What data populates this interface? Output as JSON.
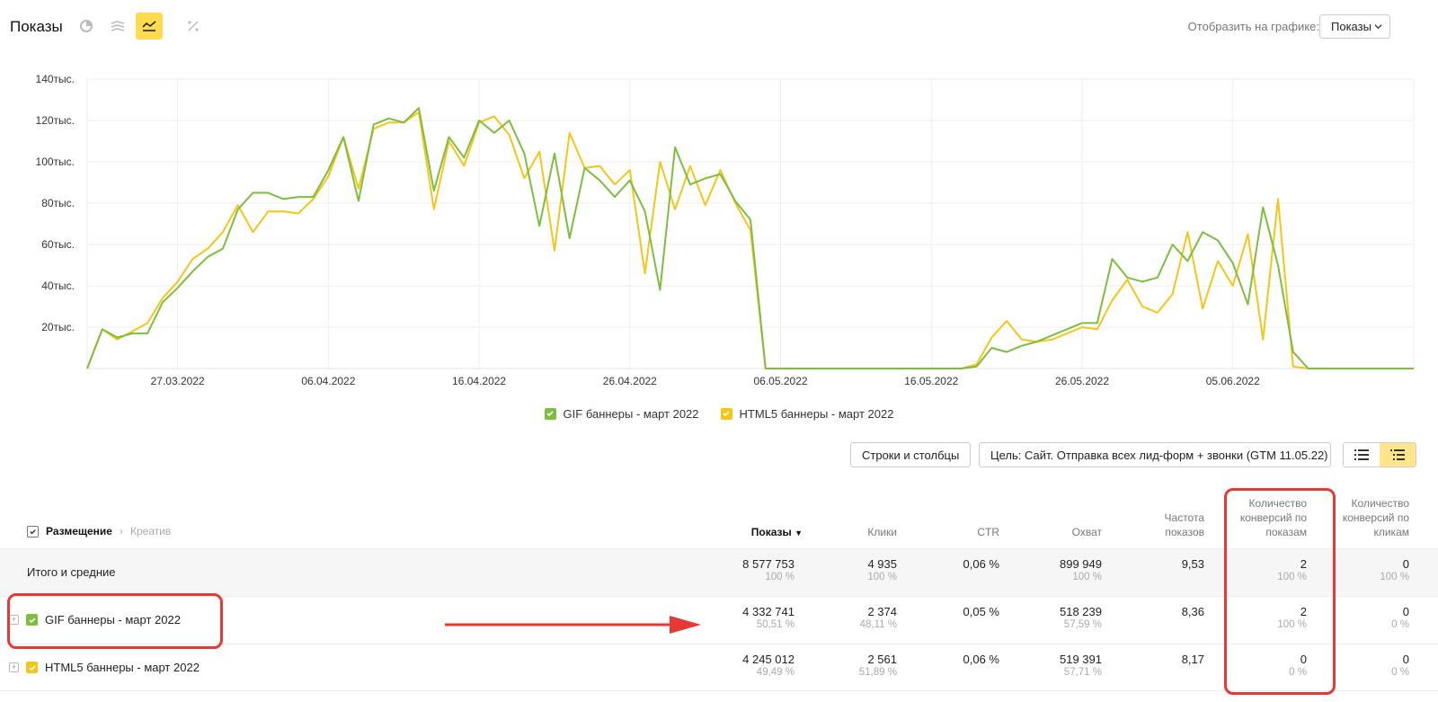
{
  "header": {
    "title": "Показы",
    "display_label": "Отобразить на графике:",
    "display_value": "Показы"
  },
  "chart_data": {
    "type": "line",
    "y_ticks": [
      "20тыс.",
      "40тыс.",
      "60тыс.",
      "80тыс.",
      "100тыс.",
      "120тыс.",
      "140тыс."
    ],
    "x_ticks": [
      "27.03.2022",
      "06.04.2022",
      "16.04.2022",
      "26.04.2022",
      "06.05.2022",
      "16.05.2022",
      "26.05.2022",
      "05.06.2022"
    ],
    "ylim": [
      0,
      140000
    ],
    "grid": true,
    "legend_position": "bottom-center",
    "series": [
      {
        "name": "GIF баннеры - март 2022",
        "color": "#7dbd3f",
        "values": [
          0,
          19000,
          15000,
          17000,
          17000,
          32000,
          39000,
          47000,
          54000,
          58000,
          77000,
          85000,
          85000,
          82000,
          83000,
          83000,
          96000,
          112000,
          81000,
          118000,
          121000,
          119000,
          126000,
          86000,
          112000,
          102000,
          120000,
          114000,
          120000,
          104000,
          69000,
          104000,
          63000,
          97000,
          91000,
          83000,
          91000,
          76000,
          38000,
          107000,
          89000,
          92000,
          94000,
          81000,
          72000,
          0,
          0,
          0,
          0,
          0,
          0,
          0,
          0,
          0,
          0,
          0,
          0,
          0,
          0,
          1000,
          10000,
          8000,
          11000,
          13000,
          16000,
          19000,
          22000,
          22000,
          53000,
          44000,
          42000,
          44000,
          60000,
          52000,
          66000,
          62000,
          51000,
          31000,
          78000,
          50000,
          8000,
          0,
          0,
          0,
          0,
          0,
          0,
          0,
          0
        ]
      },
      {
        "name": "HTML5 баннеры - март 2022",
        "color": "#f5c518",
        "values": [
          0,
          19000,
          14000,
          18000,
          22000,
          34000,
          42000,
          53000,
          58000,
          66000,
          79000,
          66000,
          76000,
          76000,
          75000,
          82000,
          93000,
          112000,
          87000,
          116000,
          119000,
          119000,
          124000,
          77000,
          110000,
          98000,
          119000,
          122000,
          113000,
          92000,
          105000,
          57000,
          114000,
          97000,
          98000,
          89000,
          96000,
          46000,
          100000,
          77000,
          98000,
          79000,
          96000,
          80000,
          67000,
          0,
          0,
          0,
          0,
          0,
          0,
          0,
          0,
          0,
          0,
          0,
          0,
          0,
          0,
          2000,
          15000,
          23000,
          14000,
          13000,
          14000,
          17000,
          20000,
          19000,
          33000,
          43000,
          30000,
          27000,
          36000,
          66000,
          29000,
          52000,
          40000,
          65000,
          14000,
          82000,
          1000,
          0,
          0,
          0,
          0,
          0,
          0,
          0,
          0
        ]
      }
    ]
  },
  "toolbar": {
    "rows_columns_label": "Строки и столбцы",
    "goal_label": "Цель: Сайт. Отправка всех лид-форм + звонки (GTM 11.05.22)"
  },
  "table": {
    "breadcrumb_active": "Размещение",
    "breadcrumb_separator": "›",
    "breadcrumb_next": "Креатив",
    "columns": {
      "shows": "Показы",
      "shows_sort": "▼",
      "clicks": "Клики",
      "ctr": "CTR",
      "reach": "Охват",
      "freq_l1": "Частота",
      "freq_l2": "показов",
      "conv_views_l1": "Количество",
      "conv_views_l2": "конверсий по",
      "conv_views_l3": "показам",
      "conv_clicks_l1": "Количество",
      "conv_clicks_l2": "конверсий по",
      "conv_clicks_l3": "кликам"
    },
    "total": {
      "label": "Итого и средние",
      "shows": "8 577 753",
      "shows_pct": "100 %",
      "clicks": "4 935",
      "clicks_pct": "100 %",
      "ctr": "0,06 %",
      "reach": "899 949",
      "reach_pct": "100 %",
      "freq": "9,53",
      "conv_views": "2",
      "conv_views_pct": "100 %",
      "conv_clicks": "0",
      "conv_clicks_pct": "100 %"
    },
    "rows": [
      {
        "label": "GIF баннеры - март 2022",
        "color": "#7dbd3f",
        "shows": "4 332 741",
        "shows_pct": "50,51 %",
        "clicks": "2 374",
        "clicks_pct": "48,11 %",
        "ctr": "0,05 %",
        "reach": "518 239",
        "reach_pct": "57,59 %",
        "freq": "8,36",
        "conv_views": "2",
        "conv_views_pct": "100 %",
        "conv_clicks": "0",
        "conv_clicks_pct": "0 %"
      },
      {
        "label": "HTML5 баннеры - март 2022",
        "color": "#f5c518",
        "shows": "4 245 012",
        "shows_pct": "49,49 %",
        "clicks": "2 561",
        "clicks_pct": "51,89 %",
        "ctr": "0,06 %",
        "reach": "519 391",
        "reach_pct": "57,71 %",
        "freq": "8,17",
        "conv_views": "0",
        "conv_views_pct": "0 %",
        "conv_clicks": "0",
        "conv_clicks_pct": "0 %"
      }
    ]
  },
  "annotation_color": "#e53935"
}
